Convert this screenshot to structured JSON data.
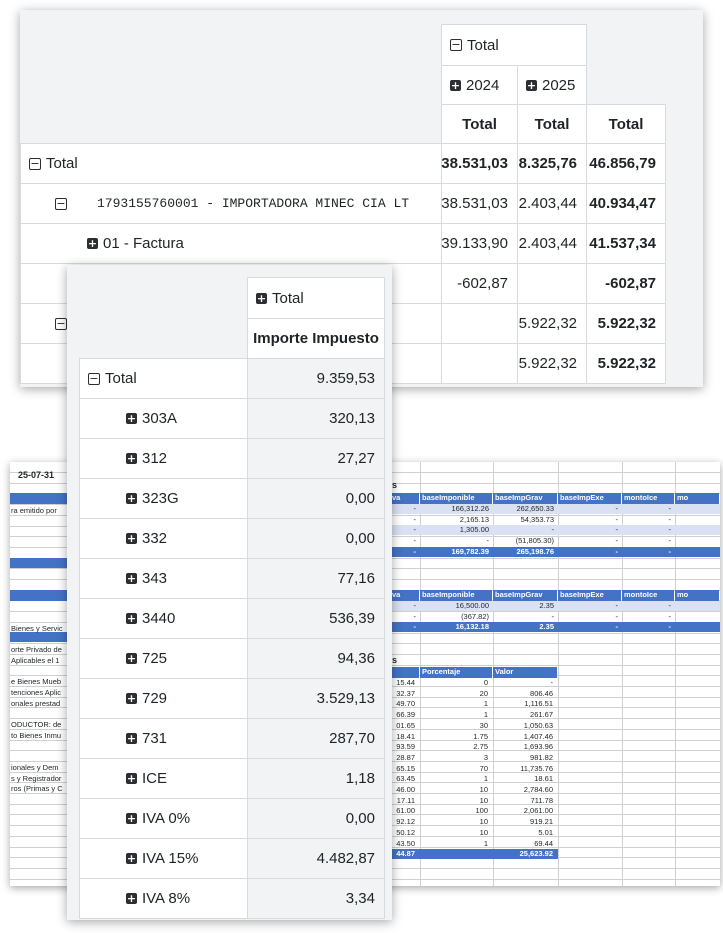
{
  "card1": {
    "h_total": "Total",
    "h_2024": "2024",
    "h_2025": "2025",
    "h_col_total": "Total",
    "rows": [
      {
        "label": "Total",
        "v2024": "38.531,03",
        "v2025": "8.325,76",
        "vtot": "46.856,79"
      },
      {
        "label": "1793155760001 - IMPORTADORA MINEC CIA LT",
        "v2024": "38.531,03",
        "v2025": "2.403,44",
        "vtot": "40.934,47"
      },
      {
        "label": "01 - Factura",
        "v2024": "39.133,90",
        "v2025": "2.403,44",
        "vtot": "41.537,34"
      },
      {
        "label": "",
        "v2024": "-602,87",
        "v2025": "",
        "vtot": "-602,87"
      },
      {
        "label": "",
        "v2024": "",
        "v2025": "5.922,32",
        "vtot": "5.922,32"
      },
      {
        "label": "",
        "v2024": "",
        "v2025": "5.922,32",
        "vtot": "5.922,32"
      }
    ]
  },
  "card2": {
    "h_total": "Total",
    "h_measure": "Importe Impuesto",
    "total_label": "Total",
    "total_value": "9.359,53",
    "rows": [
      {
        "label": "303A",
        "value": "320,13"
      },
      {
        "label": "312",
        "value": "27,27"
      },
      {
        "label": "323G",
        "value": "0,00"
      },
      {
        "label": "332",
        "value": "0,00"
      },
      {
        "label": "343",
        "value": "77,16"
      },
      {
        "label": "3440",
        "value": "536,39"
      },
      {
        "label": "725",
        "value": "94,36"
      },
      {
        "label": "729",
        "value": "3.529,13"
      },
      {
        "label": "731",
        "value": "287,70"
      },
      {
        "label": "ICE",
        "value": "1,18"
      },
      {
        "label": "IVA 0%",
        "value": "0,00"
      },
      {
        "label": "IVA 15%",
        "value": "4.482,87"
      },
      {
        "label": "IVA 8%",
        "value": "3,34"
      }
    ]
  },
  "sheet": {
    "date": "25-07-31",
    "left_labels": [
      "ra emitido por",
      "",
      "",
      "",
      "",
      "",
      "",
      "",
      "",
      "",
      "",
      "Bienes y Servic",
      "",
      "orte Privado de",
      "Aplicables el 1",
      "",
      "e Bienes Mueb",
      "tenciones Aplic",
      "onales prestad",
      "",
      "ODUCTOR: de",
      "to Bienes Inmu",
      "",
      "",
      "ionales y Dem",
      "s y Registrador",
      "ros (Primas y C"
    ],
    "t1_headers": [
      "va",
      "baseImponible",
      "baseImpGrav",
      "baseImpExe",
      "montoIce",
      "mo"
    ],
    "t1_rows": [
      [
        "-",
        "166,312.26",
        "262,650.33",
        "-",
        "-"
      ],
      [
        "-",
        "2,165.13",
        "54,353.73",
        "-",
        "-"
      ],
      [
        "-",
        "1,305.00",
        "-",
        "-",
        "-"
      ],
      [
        "-",
        "-",
        "(51,805.30)",
        "-",
        "-"
      ]
    ],
    "t1_total": [
      "-",
      "169,782.39",
      "265,198.76",
      "-",
      "-"
    ],
    "t2_headers": [
      "va",
      "baseImponible",
      "baseImpGrav",
      "baseImpExe",
      "montoIce",
      "mo"
    ],
    "t2_rows": [
      [
        "-",
        "16,500.00",
        "2.35",
        "-",
        "-"
      ],
      [
        "-",
        "(367.82)",
        "-",
        "-",
        "-"
      ]
    ],
    "t2_total": [
      "-",
      "16,132.18",
      "2.35",
      "-",
      "-"
    ],
    "t3_title": "s",
    "t3_headers": [
      "",
      "Porcentaje",
      "Valor"
    ],
    "t3_rows": [
      [
        "15.44",
        "0",
        "-"
      ],
      [
        "32.37",
        "20",
        "806.46"
      ],
      [
        "49.70",
        "1",
        "1,116.51"
      ],
      [
        "66.39",
        "1",
        "261.67"
      ],
      [
        "01.65",
        "30",
        "1,050.63"
      ],
      [
        "18.41",
        "1.75",
        "1,407.46"
      ],
      [
        "93.59",
        "2.75",
        "1,693.96"
      ],
      [
        "28.87",
        "3",
        "981.82"
      ],
      [
        "65.15",
        "70",
        "11,735.76"
      ],
      [
        "63.45",
        "1",
        "18.61"
      ],
      [
        "46.00",
        "10",
        "2,784.60"
      ],
      [
        "17.11",
        "10",
        "711.78"
      ],
      [
        "61.00",
        "100",
        "2,061.00"
      ],
      [
        "92.12",
        "10",
        "919.21"
      ],
      [
        "50.12",
        "10",
        "5.01"
      ],
      [
        "43.50",
        "1",
        "69.44"
      ]
    ],
    "t3_total": [
      "44.87",
      "",
      "25,623.92"
    ],
    "t1_title": "s"
  }
}
